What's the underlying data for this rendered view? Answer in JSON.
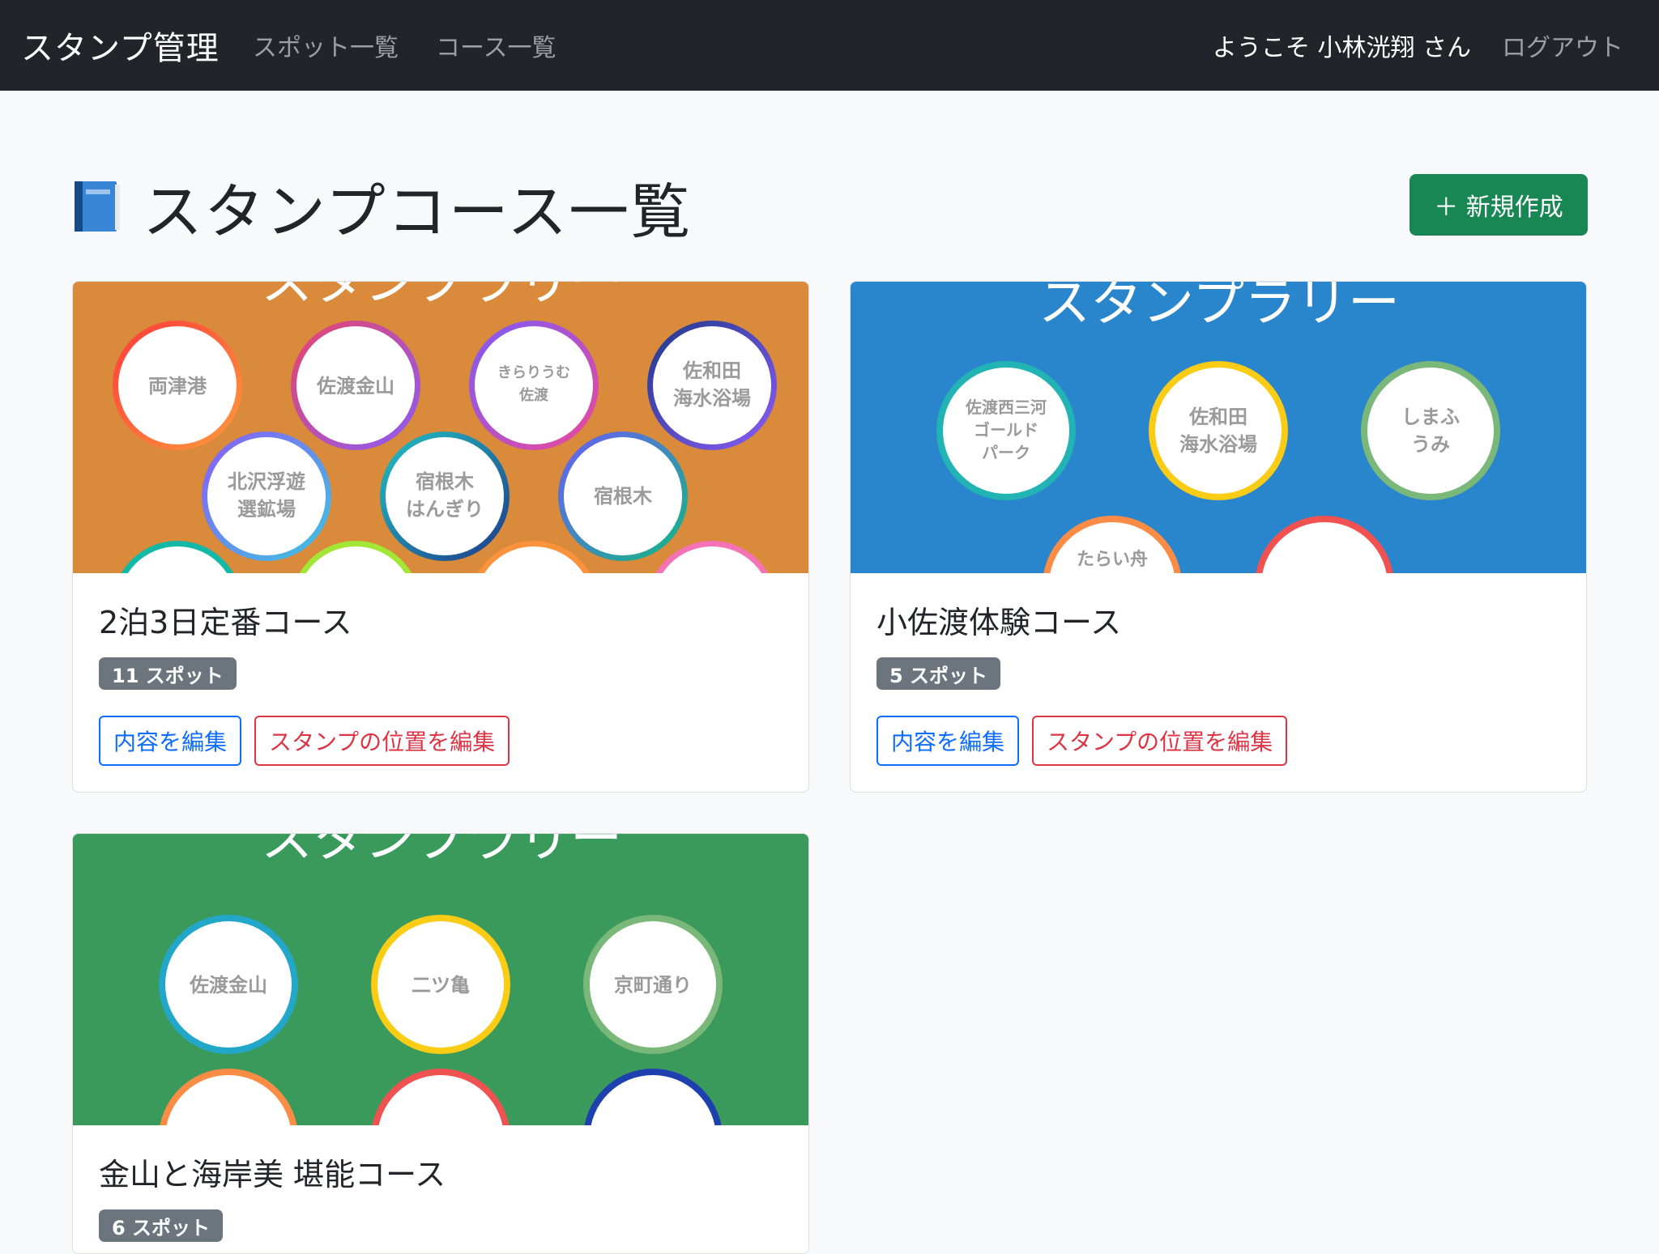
{
  "navbar": {
    "brand": "スタンプ管理",
    "links": [
      "スポット一覧",
      "コース一覧"
    ],
    "welcome": "ようこそ 小林洸翔 さん",
    "logout": "ログアウト"
  },
  "header": {
    "title": "スタンプコース一覧",
    "icon": "book-icon",
    "new_button": "＋ 新規作成"
  },
  "colors": {
    "navbar_bg": "#212529",
    "success": "#198754",
    "primary": "#0d6efd",
    "danger": "#dc3545",
    "badge": "#6c757d"
  },
  "courses": [
    {
      "title": "2泊3日定番コース",
      "spots_badge": "11 スポット",
      "image_bg": "#d98a3a",
      "image_heading": "スタンプラリー",
      "stamps": [
        "両津港",
        "佐渡金山",
        "きらりうむ",
        "佐渡",
        "佐和田",
        "海水浴場",
        "北沢浮遊",
        "選鉱場",
        "宿根木",
        "はんぎり",
        "宿根木"
      ],
      "edit_button": "内容を編集",
      "position_button": "スタンプの位置を編集"
    },
    {
      "title": "小佐渡体験コース",
      "spots_badge": "5 スポット",
      "image_bg": "#2a86cc",
      "image_heading": "スタンプラリー",
      "stamps": [
        "佐渡西三河",
        "ゴールド",
        "パーク",
        "佐和田",
        "海水浴場",
        "しまふ",
        "うみ",
        "たらい舟"
      ],
      "edit_button": "内容を編集",
      "position_button": "スタンプの位置を編集"
    },
    {
      "title": "金山と海岸美 堪能コース",
      "spots_badge": "6 スポット",
      "image_bg": "#3a9a5c",
      "image_heading": "スタンプラリー",
      "stamps": [
        "佐渡金山",
        "二ツ亀",
        "京町通り"
      ]
    }
  ]
}
